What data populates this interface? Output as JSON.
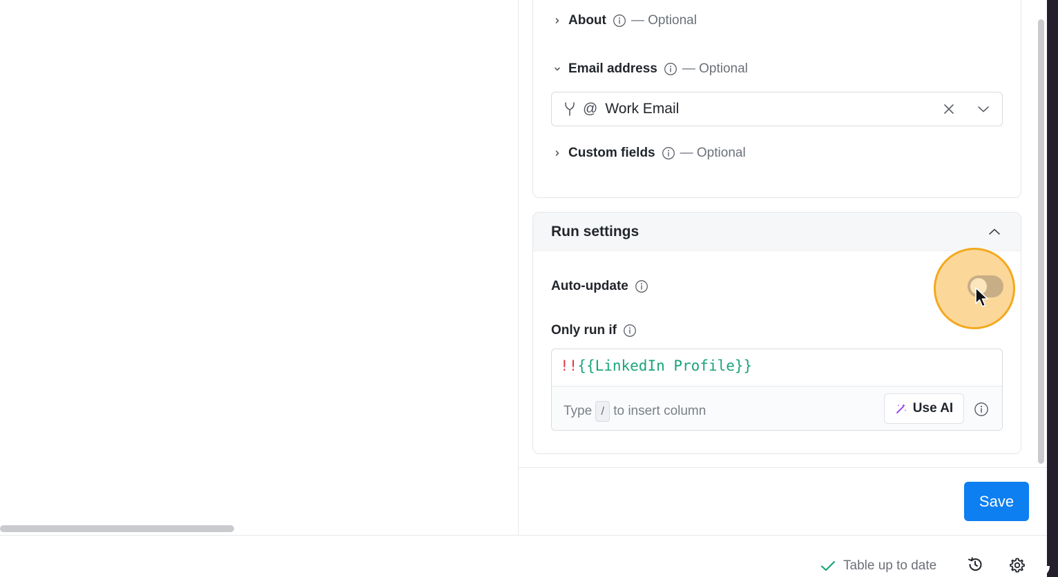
{
  "sections": {
    "about": {
      "title": "About",
      "optional": "— Optional",
      "expanded": false
    },
    "email": {
      "title": "Email address",
      "optional": "— Optional",
      "expanded": true,
      "value": "Work Email",
      "prefix_symbol": "@"
    },
    "custom_fields": {
      "title": "Custom fields",
      "optional": "— Optional",
      "expanded": false
    }
  },
  "run_settings": {
    "title": "Run settings",
    "auto_update": {
      "label": "Auto-update",
      "enabled": false
    },
    "only_run_if": {
      "label": "Only run if",
      "formula_negation": "!!",
      "formula_reference": "{{LinkedIn Profile}}",
      "hint_prefix": "Type",
      "hint_key": "/",
      "hint_suffix": "to insert column",
      "use_ai_label": "Use AI"
    }
  },
  "actions": {
    "save_label": "Save"
  },
  "status_bar": {
    "status_text": "Table up to date"
  },
  "colors": {
    "primary": "#0d7ff0",
    "success": "#1aa37a",
    "negation": "#e0394b",
    "highlight": "#f4a81c"
  },
  "icons": [
    "chevron-right-icon",
    "chevron-down-icon",
    "info-icon",
    "fork-icon",
    "close-icon",
    "chevron-up-icon",
    "magic-wand-icon",
    "check-icon",
    "history-icon",
    "settings-icon",
    "cursor-icon"
  ]
}
